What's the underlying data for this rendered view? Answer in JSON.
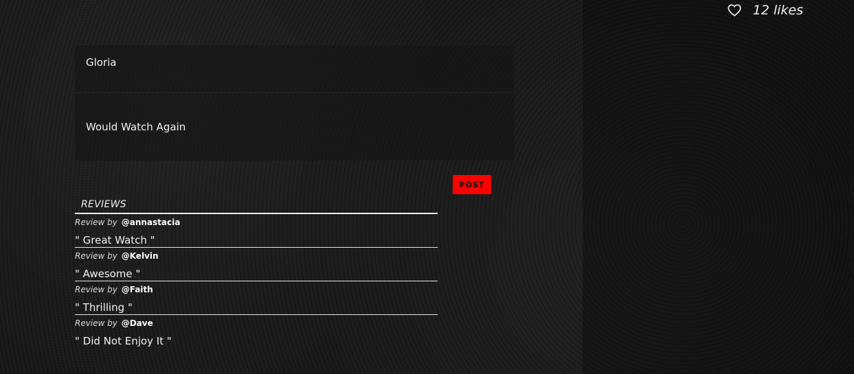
{
  "likes": {
    "icon": "heart-icon",
    "label": "12 likes"
  },
  "form": {
    "name_value": "Gloria",
    "review_value": "Would Watch Again",
    "post_label": "POST",
    "post_color": "#ff0000"
  },
  "reviews": {
    "title": "REVIEWS",
    "by_label": "Review by",
    "items": [
      {
        "author": "@annastacia",
        "text": "\" Great Watch \""
      },
      {
        "author": "@Kelvin",
        "text": "\" Awesome \""
      },
      {
        "author": "@Faith",
        "text": "\" Thrilling \""
      },
      {
        "author": "@Dave",
        "text": "\" Did Not Enjoy It \""
      }
    ]
  }
}
